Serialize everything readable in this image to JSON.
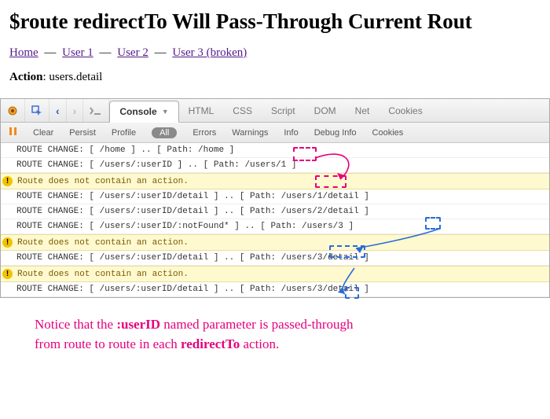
{
  "header": {
    "title": "$route redirectTo Will Pass-Through Current Rout"
  },
  "nav": {
    "items": [
      "Home",
      "User 1",
      "User 2",
      "User 3 (broken)"
    ],
    "separator": "—"
  },
  "action": {
    "label": "Action",
    "value": "users.detail"
  },
  "devtools": {
    "tabs": [
      "Console",
      "HTML",
      "CSS",
      "Script",
      "DOM",
      "Net",
      "Cookies"
    ],
    "active_tab": "Console",
    "subbar": [
      "Clear",
      "Persist",
      "Profile"
    ],
    "filters": [
      "All",
      "Errors",
      "Warnings",
      "Info",
      "Debug Info",
      "Cookies"
    ],
    "active_filter": "All"
  },
  "console": [
    {
      "type": "log",
      "text": "ROUTE CHANGE: [ /home ] .. [ Path: /home ]"
    },
    {
      "type": "log",
      "text": "ROUTE CHANGE: [ /users/:userID ] .. [ Path: /users/1 ]"
    },
    {
      "type": "warn",
      "text": "Route does not contain an action."
    },
    {
      "type": "log",
      "text": "ROUTE CHANGE: [ /users/:userID/detail ] .. [ Path: /users/1/detail ]"
    },
    {
      "type": "log",
      "text": "ROUTE CHANGE: [ /users/:userID/detail ] .. [ Path: /users/2/detail ]"
    },
    {
      "type": "log",
      "text": "ROUTE CHANGE: [ /users/:userID/:notFound* ] .. [ Path: /users/3 ]"
    },
    {
      "type": "warn",
      "text": "Route does not contain an action."
    },
    {
      "type": "log",
      "text": "ROUTE CHANGE: [ /users/:userID/detail ] .. [ Path: /users/3/detail ]"
    },
    {
      "type": "warn",
      "text": "Route does not contain an action."
    },
    {
      "type": "log",
      "text": "ROUTE CHANGE: [ /users/:userID/detail ] .. [ Path: /users/3/detail ]"
    }
  ],
  "annotation": {
    "line1_a": "Notice that the ",
    "line1_b": ":userID",
    "line1_c": " named parameter is passed-through",
    "line2_a": "from route to route in each ",
    "line2_b": "redirectTo",
    "line2_c": " action."
  }
}
